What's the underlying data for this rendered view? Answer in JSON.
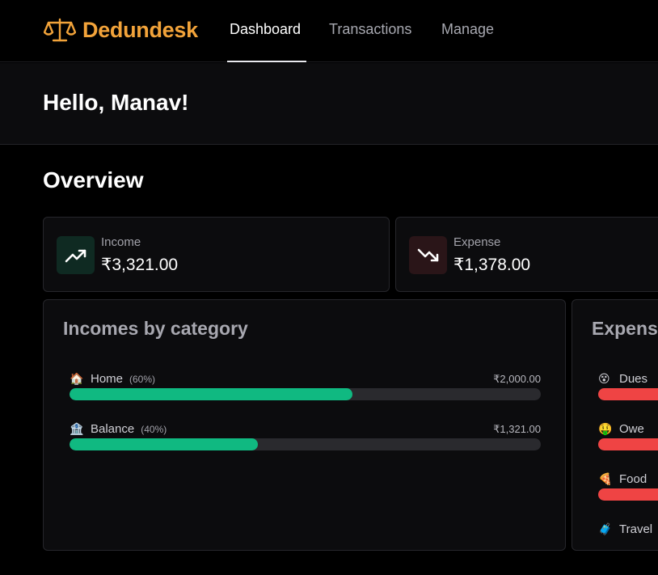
{
  "brand": {
    "name": "Dedundesk",
    "icon": "scales-icon",
    "color": "#f2a33a"
  },
  "nav": {
    "tabs": [
      {
        "label": "Dashboard",
        "active": true
      },
      {
        "label": "Transactions",
        "active": false
      },
      {
        "label": "Manage",
        "active": false
      }
    ]
  },
  "greeting": "Hello, Manav!",
  "overview": {
    "title": "Overview",
    "income": {
      "label": "Income",
      "value": "₹3,321.00",
      "icon": "trending-up-icon"
    },
    "expense": {
      "label": "Expense",
      "value": "₹1,378.00",
      "icon": "trending-down-icon"
    }
  },
  "incomes_by_category": {
    "title": "Incomes by category",
    "color": "#10b981",
    "items": [
      {
        "emoji": "🏠",
        "name": "Home",
        "percent_label": "(60%)",
        "amount": "₹2,000.00",
        "fraction": 0.6
      },
      {
        "emoji": "🏦",
        "name": "Balance",
        "percent_label": "(40%)",
        "amount": "₹1,321.00",
        "fraction": 0.4
      }
    ]
  },
  "expenses_by_category": {
    "title": "Expense",
    "color": "#ef4444",
    "items": [
      {
        "emoji": "😵",
        "name": "Dues"
      },
      {
        "emoji": "🤑",
        "name": "Owe"
      },
      {
        "emoji": "🍕",
        "name": "Food"
      },
      {
        "emoji": "🧳",
        "name": "Travel"
      }
    ]
  }
}
